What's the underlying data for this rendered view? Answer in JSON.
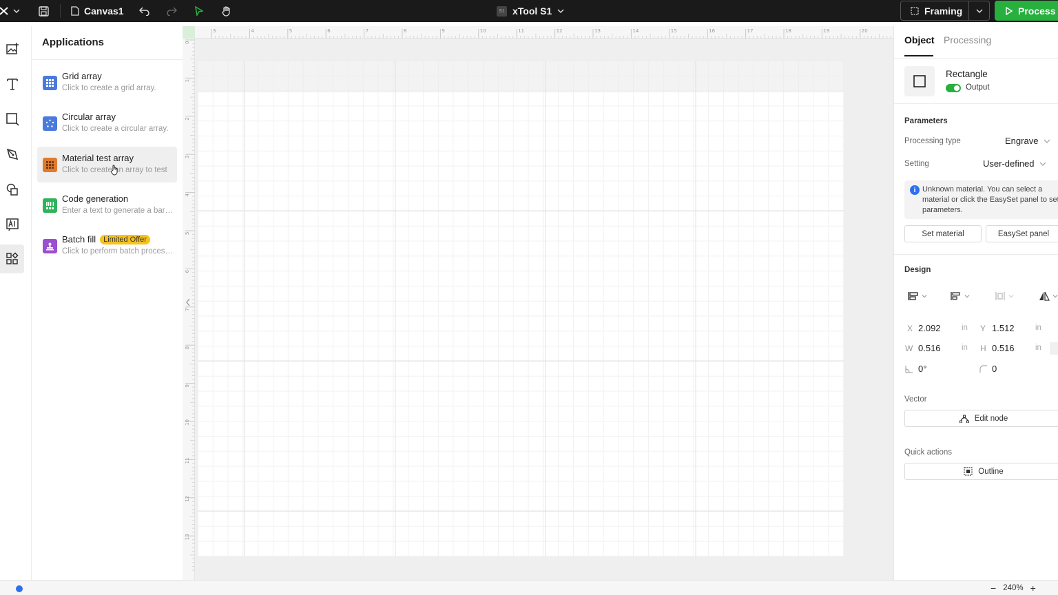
{
  "topbar": {
    "file_name": "Canvas1",
    "device_name": "xTool S1",
    "device_badge": "S1",
    "framing_label": "Framing",
    "process_label": "Process"
  },
  "rail": {
    "items": [
      {
        "icon": "image-add-icon"
      },
      {
        "icon": "text-icon"
      },
      {
        "icon": "shape-icon"
      },
      {
        "icon": "pen-icon"
      },
      {
        "icon": "elements-icon"
      },
      {
        "icon": "ai-icon"
      },
      {
        "icon": "applications-icon",
        "active": true
      }
    ]
  },
  "applications": {
    "title": "Applications",
    "items": [
      {
        "name": "Grid array",
        "desc": "Click to create a grid array.",
        "color": "#4a7bdc"
      },
      {
        "name": "Circular array",
        "desc": "Click to create a circular array.",
        "color": "#4a7bdc"
      },
      {
        "name": "Material test array",
        "desc": "Click to create an array to test",
        "color": "#e07b2e"
      },
      {
        "name": "Code generation",
        "desc": "Enter a text to generate a barcode",
        "color": "#2fb35a"
      },
      {
        "name": "Batch fill",
        "desc": "Click to perform batch processing",
        "color": "#9b4fd1",
        "badge": "Limited Offer"
      }
    ]
  },
  "ruler": {
    "top_ticks": [
      "3",
      "4",
      "5",
      "6",
      "7",
      "8",
      "9",
      "10",
      "11",
      "12",
      "13",
      "14",
      "15",
      "16",
      "17",
      "18",
      "19",
      "20"
    ],
    "left_ticks": [
      "0",
      "1",
      "2",
      "3",
      "4",
      "5",
      "6",
      "7",
      "8",
      "9",
      "10",
      "11",
      "12",
      "13"
    ]
  },
  "right_panel": {
    "tabs": [
      "Object",
      "Processing"
    ],
    "object": {
      "name": "Rectangle",
      "output_label": "Output",
      "output_on": true
    },
    "parameters": {
      "title": "Parameters",
      "processing_type_label": "Processing type",
      "processing_type_value": "Engrave",
      "setting_label": "Setting",
      "setting_value": "User-defined",
      "info": "Unknown material. You can select a material or click the EasySet panel to set parameters.",
      "set_material": "Set material",
      "easyset": "EasySet panel"
    },
    "design": {
      "title": "Design",
      "x_label": "X",
      "x": "2.092",
      "y_label": "Y",
      "y": "1.512",
      "w_label": "W",
      "w": "0.516",
      "h_label": "H",
      "h": "0.516",
      "unit": "in",
      "rotation": "0°",
      "corner": "0"
    },
    "vector": {
      "title": "Vector",
      "edit_node": "Edit node"
    },
    "quick_actions": {
      "title": "Quick actions",
      "outline": "Outline"
    }
  },
  "bottombar": {
    "zoom": "240%"
  }
}
